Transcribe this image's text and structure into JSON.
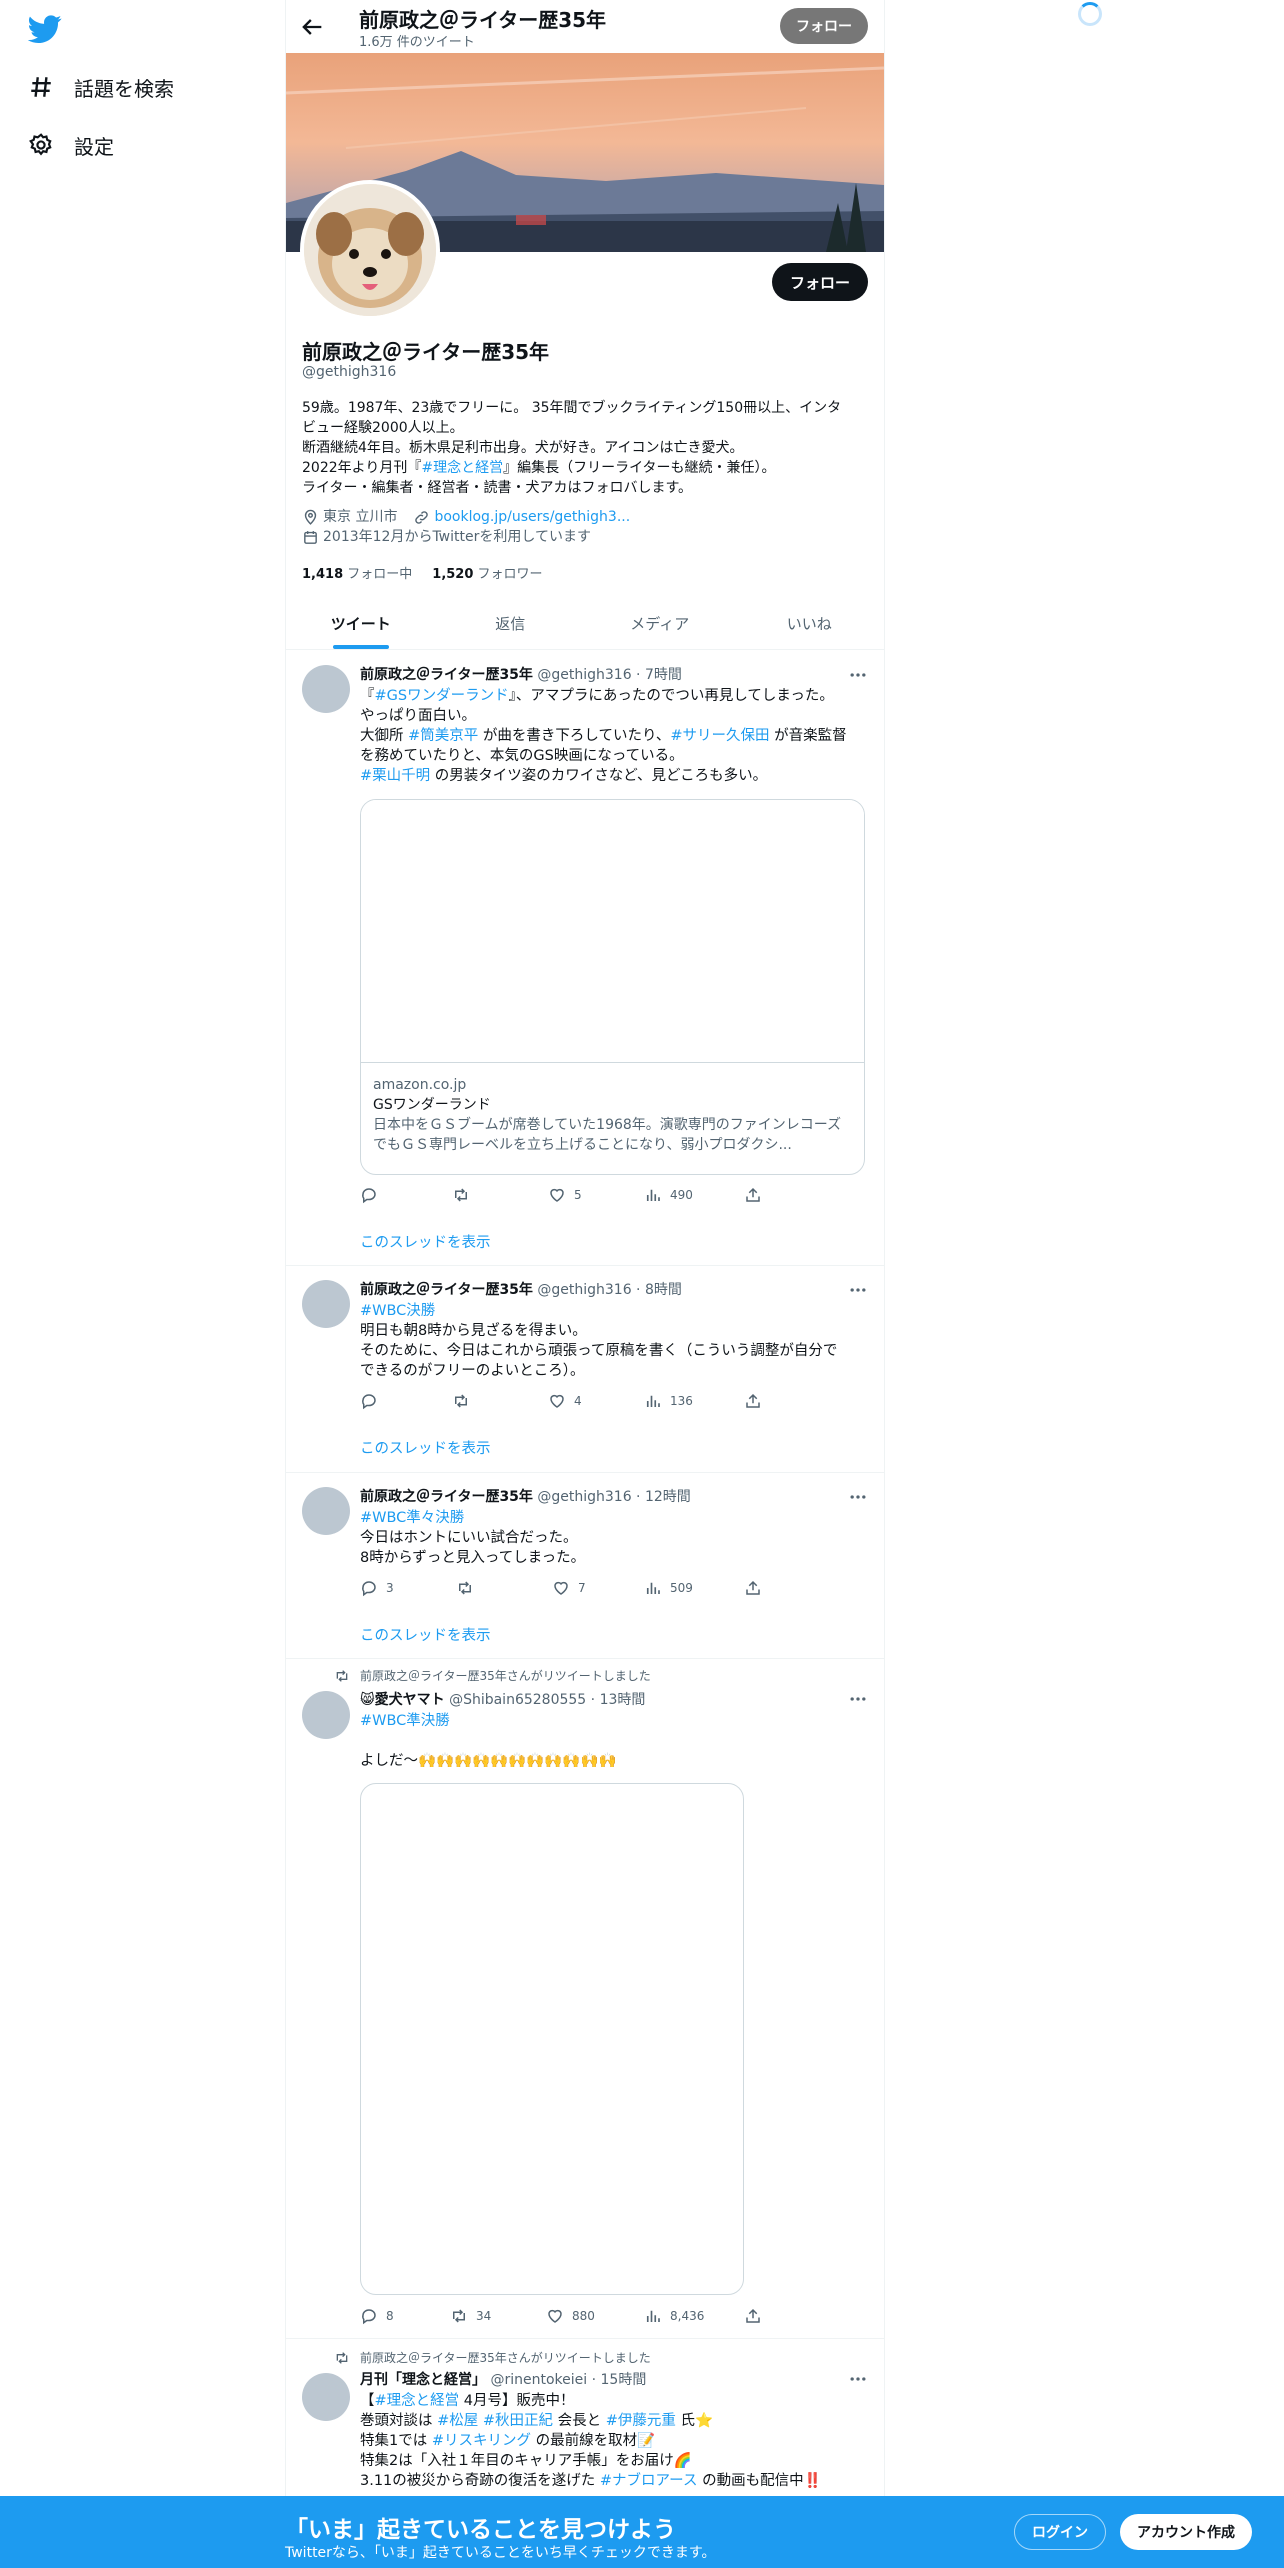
{
  "nav": {
    "explore": "話題を検索",
    "settings": "設定"
  },
  "header": {
    "name": "前原政之＠ライター歴35年",
    "tweet_count": "1.6万 件のツイート",
    "follow_button": "フォロー"
  },
  "profile": {
    "name": "前原政之＠ライター歴35年",
    "handle": "@gethigh316",
    "follow_button": "フォロー",
    "bio": {
      "line1": "59歳。1987年、23歳でフリーに。 35年間でブックライティング150冊以上、インタ",
      "line2": "ビュー経験2000人以上。",
      "line3": "断酒継続4年目。栃木県足利市出身。犬が好き。アイコンは亡き愛犬。",
      "line4a": "2022年より月刊『",
      "line4tag": "#理念と経営",
      "line4b": "』編集長（フリーライターも継続・兼任）。",
      "line5": "ライター・編集者・経営者・読書・犬アカはフォロバします。"
    },
    "location": "東京 立川市",
    "website": "booklog.jp/users/gethigh3...",
    "joined": "2013年12月からTwitterを利用しています",
    "following_count": "1,418",
    "following_label": "フォロー中",
    "followers_count": "1,520",
    "followers_label": "フォロワー"
  },
  "tabs": [
    "ツイート",
    "返信",
    "メディア",
    "いいね"
  ],
  "tweets": [
    {
      "name": "前原政之＠ライター歴35年",
      "handle": "@gethigh316",
      "time": "7時間",
      "l1a": "『",
      "l1tag": "#GSワンダーランド",
      "l1b": "』、アマプラにあったのでつい再見してしまった。",
      "l2": "やっぱり面白い。",
      "l3a": "大御所 ",
      "l3tag1": "#筒美京平",
      "l3b": " が曲を書き下ろしていたり、",
      "l3tag2": "#サリー久保田",
      "l3c": " が音楽監督",
      "l4": "を務めていたりと、本気のGS映画になっている。",
      "l5tag": "#栗山千明",
      "l5b": " の男装タイツ姿のカワイさなど、見どころも多い。",
      "card": {
        "domain": "amazon.co.jp",
        "title": "GSワンダーランド",
        "desc": "日本中をＧＳブームが席巻していた1968年。演歌専門のファインレコーズでもＧＳ専門レーベルを立ち上げることになり、弱小プロダクシ..."
      },
      "replies": "",
      "retweets": "",
      "likes": "5",
      "views": "490",
      "show_thread": "このスレッドを表示"
    },
    {
      "name": "前原政之＠ライター歴35年",
      "handle": "@gethigh316",
      "time": "8時間",
      "tag": "#WBC決勝",
      "l2": "明日も朝8時から見ざるを得まい。",
      "l3": "そのために、今日はこれから頑張って原稿を書く（こういう調整が自分で",
      "l4": "できるのがフリーのよいところ）。",
      "replies": "",
      "retweets": "",
      "likes": "4",
      "views": "136",
      "show_thread": "このスレッドを表示"
    },
    {
      "name": "前原政之＠ライター歴35年",
      "handle": "@gethigh316",
      "time": "12時間",
      "tag": "#WBC準々決勝",
      "l2": "今日はホントにいい試合だった。",
      "l3": "8時からずっと見入ってしまった。",
      "replies": "3",
      "retweets": "",
      "likes": "7",
      "views": "509",
      "show_thread": "このスレッドを表示"
    },
    {
      "retweeted_by": "前原政之＠ライター歴35年さんがリツイートしました",
      "name": "😸愛犬ヤマト",
      "handle": "@Shibain65280555",
      "time": "13時間",
      "tag": "#WBC準決勝",
      "l2": "よしだ〜🙌🙌🙌🙌🙌🙌🙌🙌🙌🙌🙌",
      "replies": "8",
      "retweets": "34",
      "likes": "880",
      "views": "8,436"
    },
    {
      "retweeted_by": "前原政之＠ライター歴35年さんがリツイートしました",
      "name": "月刊「理念と経営」",
      "handle": "@rinentokeiei",
      "time": "15時間",
      "l1a": "【",
      "l1tag": "#理念と経営",
      "l1b": " 4月号】販売中！",
      "l2a": "巻頭対談は ",
      "l2tag1": "#松屋",
      "l2tag2": "#秋田正紀",
      "l2b": " 会長と ",
      "l2tag3": "#伊藤元重",
      "l2c": " 氏⭐",
      "l3a": "特集1では ",
      "l3tag": "#リスキリング",
      "l3b": " の最前線を取材📝",
      "l4": "特集2は「入社１年目のキャリア手帳」をお届け🌈",
      "l5a": "3.11の被災から奇跡の復活を遂げた ",
      "l5tag": "#ナブロアース",
      "l5b": " の動画も配信中‼️"
    }
  ],
  "bottom": {
    "title": "「いま」起きていることを見つけよう",
    "subtitle": "Twitterなら、「いま」起きていることをいち早くチェックできます。",
    "login": "ログイン",
    "signup": "アカウント作成"
  },
  "colors": {
    "accent": "#1d9bf0",
    "text": "#0f1419",
    "secondary": "#536471",
    "bottom_bar": "#1d9bf0"
  }
}
